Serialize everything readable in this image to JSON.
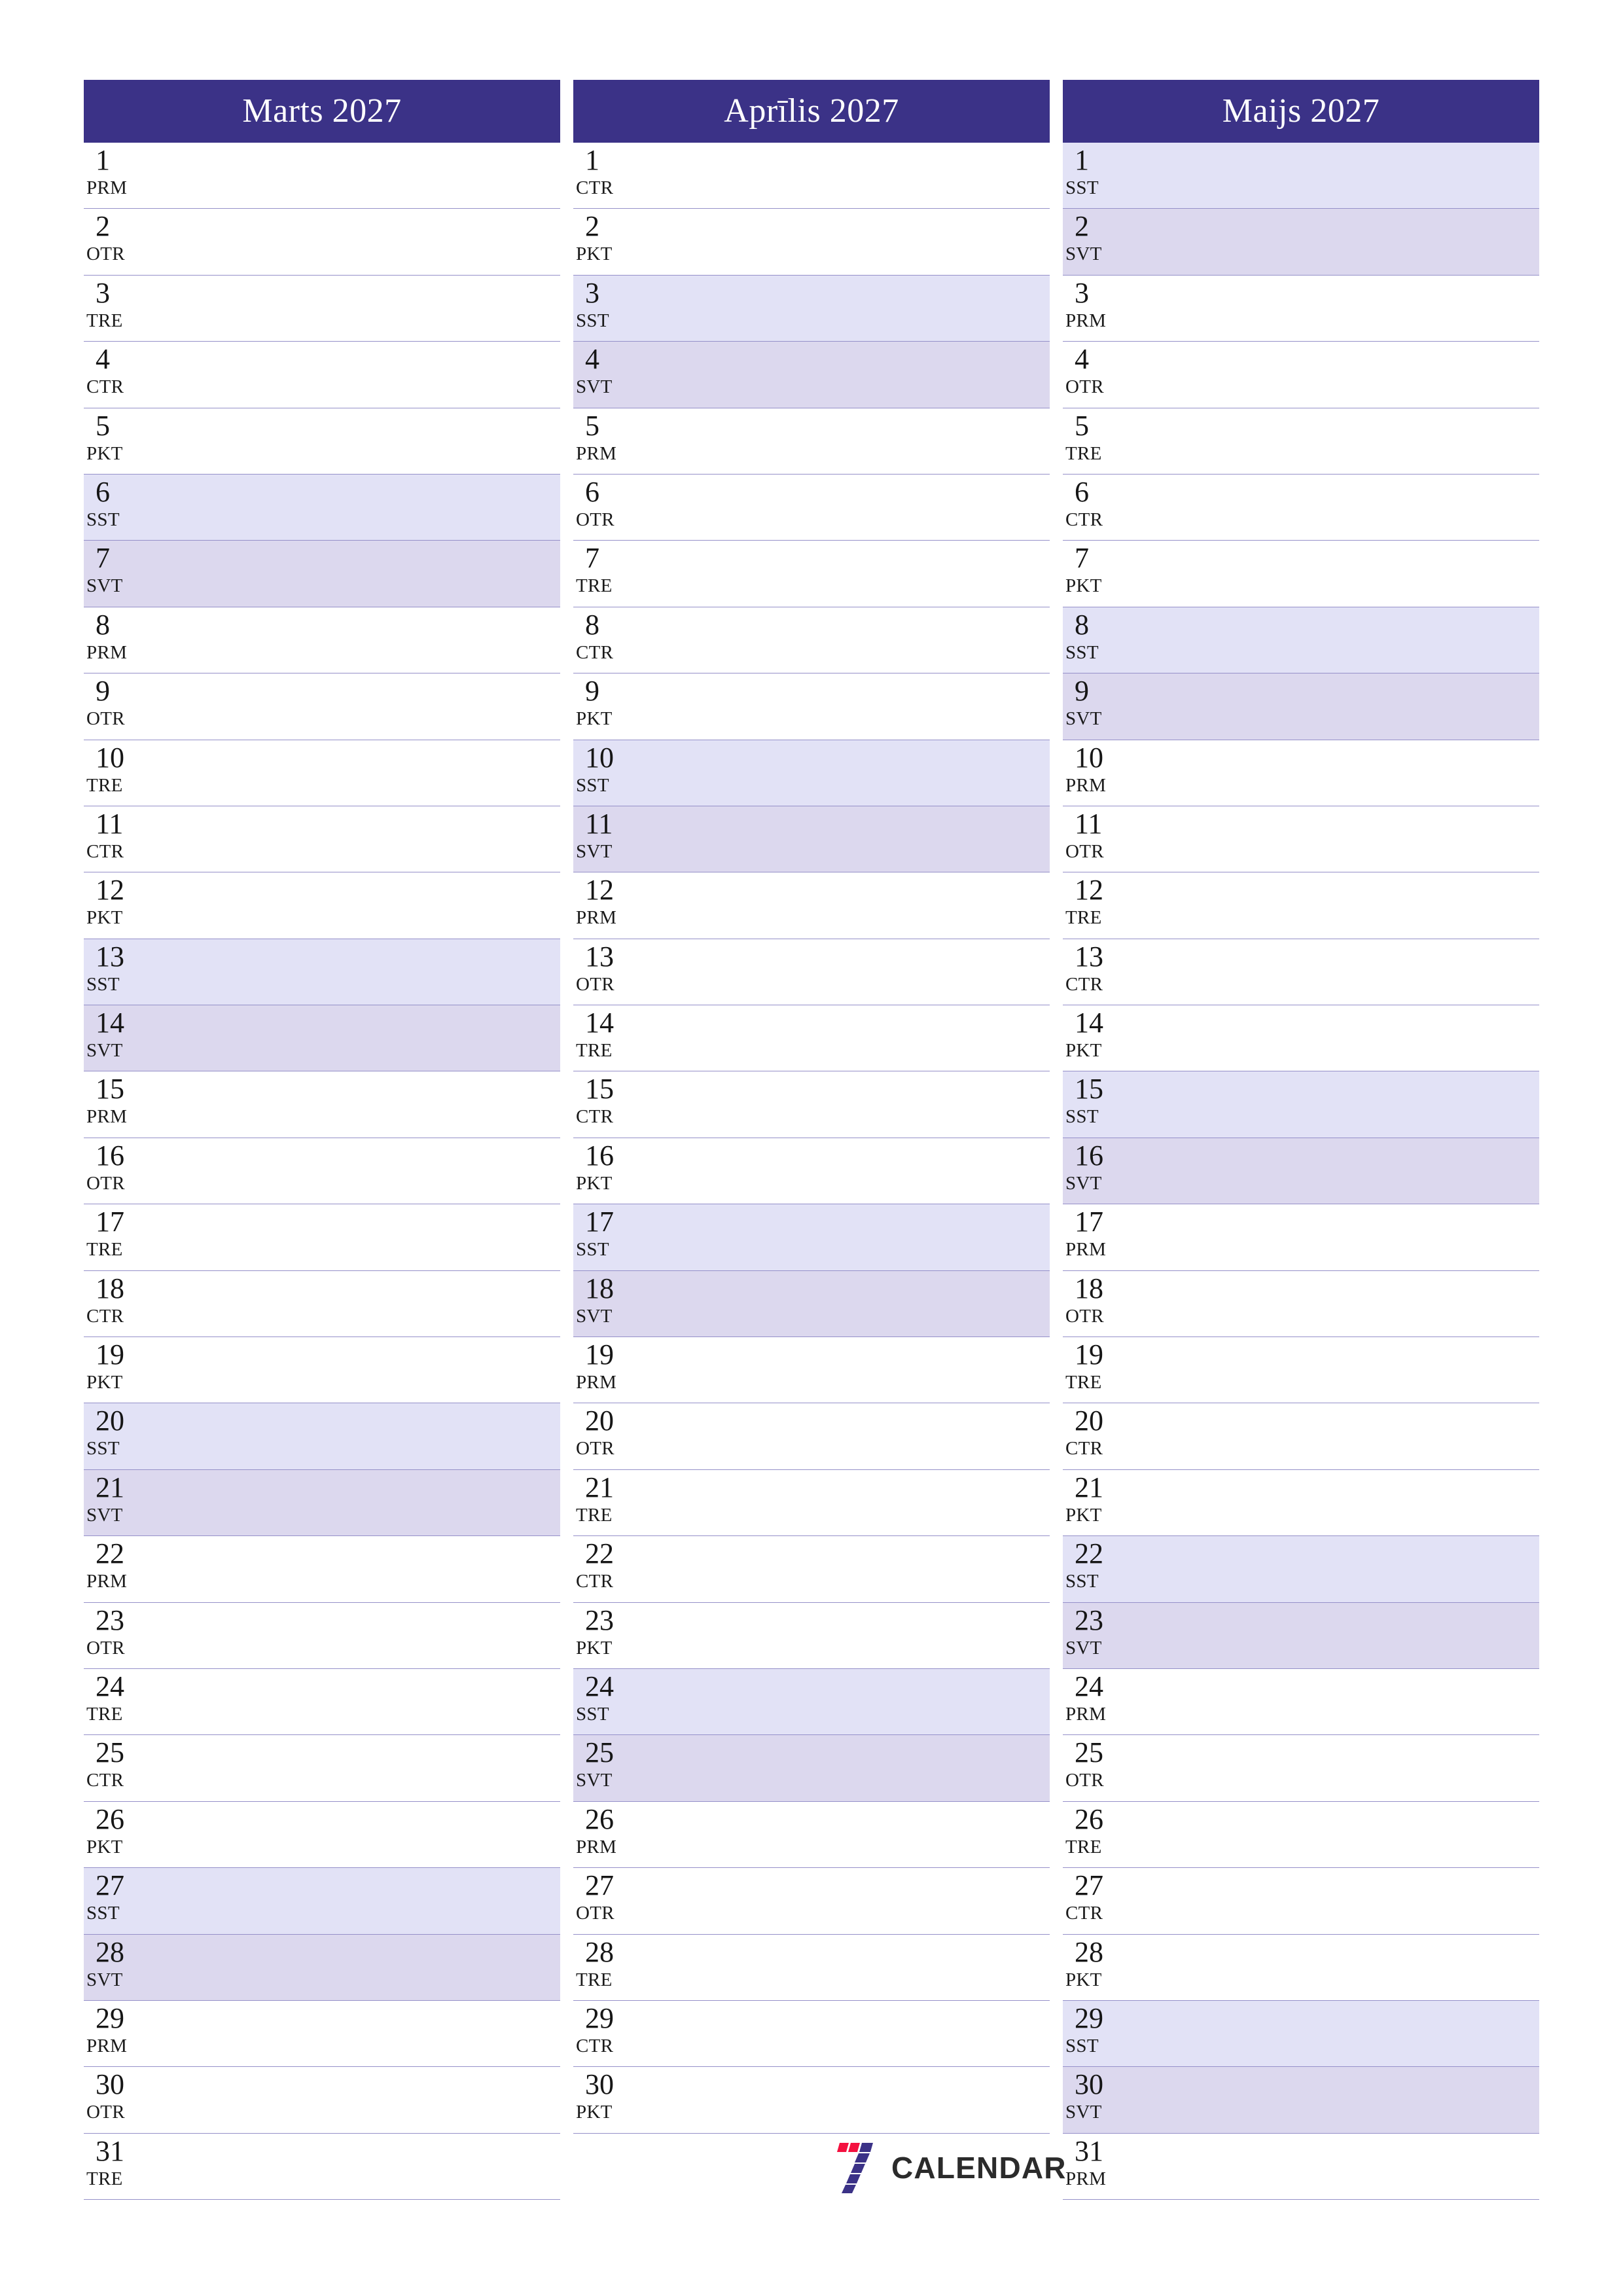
{
  "page": {
    "title": "Marts - Maijs 2027 planotajs",
    "background_color": "#ffffff",
    "header_color": "#3b3287",
    "saturday_color": "#e2e2f6",
    "sunday_color": "#dcd8ee",
    "rule_color": "#9590c9"
  },
  "weekday_abbr": {
    "monday": "PRM",
    "tuesday": "OTR",
    "wednesday": "TRE",
    "thursday": "CTR",
    "friday": "PKT",
    "saturday": "SST",
    "sunday": "SVT"
  },
  "months": [
    {
      "id": "marts",
      "title": "Marts 2027",
      "days": [
        {
          "num": "1",
          "wd": "PRM",
          "type": "weekday"
        },
        {
          "num": "2",
          "wd": "OTR",
          "type": "weekday"
        },
        {
          "num": "3",
          "wd": "TRE",
          "type": "weekday"
        },
        {
          "num": "4",
          "wd": "CTR",
          "type": "weekday"
        },
        {
          "num": "5",
          "wd": "PKT",
          "type": "weekday"
        },
        {
          "num": "6",
          "wd": "SST",
          "type": "saturday"
        },
        {
          "num": "7",
          "wd": "SVT",
          "type": "sunday"
        },
        {
          "num": "8",
          "wd": "PRM",
          "type": "weekday"
        },
        {
          "num": "9",
          "wd": "OTR",
          "type": "weekday"
        },
        {
          "num": "10",
          "wd": "TRE",
          "type": "weekday"
        },
        {
          "num": "11",
          "wd": "CTR",
          "type": "weekday"
        },
        {
          "num": "12",
          "wd": "PKT",
          "type": "weekday"
        },
        {
          "num": "13",
          "wd": "SST",
          "type": "saturday"
        },
        {
          "num": "14",
          "wd": "SVT",
          "type": "sunday"
        },
        {
          "num": "15",
          "wd": "PRM",
          "type": "weekday"
        },
        {
          "num": "16",
          "wd": "OTR",
          "type": "weekday"
        },
        {
          "num": "17",
          "wd": "TRE",
          "type": "weekday"
        },
        {
          "num": "18",
          "wd": "CTR",
          "type": "weekday"
        },
        {
          "num": "19",
          "wd": "PKT",
          "type": "weekday"
        },
        {
          "num": "20",
          "wd": "SST",
          "type": "saturday"
        },
        {
          "num": "21",
          "wd": "SVT",
          "type": "sunday"
        },
        {
          "num": "22",
          "wd": "PRM",
          "type": "weekday"
        },
        {
          "num": "23",
          "wd": "OTR",
          "type": "weekday"
        },
        {
          "num": "24",
          "wd": "TRE",
          "type": "weekday"
        },
        {
          "num": "25",
          "wd": "CTR",
          "type": "weekday"
        },
        {
          "num": "26",
          "wd": "PKT",
          "type": "weekday"
        },
        {
          "num": "27",
          "wd": "SST",
          "type": "saturday"
        },
        {
          "num": "28",
          "wd": "SVT",
          "type": "sunday"
        },
        {
          "num": "29",
          "wd": "PRM",
          "type": "weekday"
        },
        {
          "num": "30",
          "wd": "OTR",
          "type": "weekday"
        },
        {
          "num": "31",
          "wd": "TRE",
          "type": "weekday"
        }
      ]
    },
    {
      "id": "aprilis",
      "title": "Aprīlis 2027",
      "days": [
        {
          "num": "1",
          "wd": "CTR",
          "type": "weekday"
        },
        {
          "num": "2",
          "wd": "PKT",
          "type": "weekday"
        },
        {
          "num": "3",
          "wd": "SST",
          "type": "saturday"
        },
        {
          "num": "4",
          "wd": "SVT",
          "type": "sunday"
        },
        {
          "num": "5",
          "wd": "PRM",
          "type": "weekday"
        },
        {
          "num": "6",
          "wd": "OTR",
          "type": "weekday"
        },
        {
          "num": "7",
          "wd": "TRE",
          "type": "weekday"
        },
        {
          "num": "8",
          "wd": "CTR",
          "type": "weekday"
        },
        {
          "num": "9",
          "wd": "PKT",
          "type": "weekday"
        },
        {
          "num": "10",
          "wd": "SST",
          "type": "saturday"
        },
        {
          "num": "11",
          "wd": "SVT",
          "type": "sunday"
        },
        {
          "num": "12",
          "wd": "PRM",
          "type": "weekday"
        },
        {
          "num": "13",
          "wd": "OTR",
          "type": "weekday"
        },
        {
          "num": "14",
          "wd": "TRE",
          "type": "weekday"
        },
        {
          "num": "15",
          "wd": "CTR",
          "type": "weekday"
        },
        {
          "num": "16",
          "wd": "PKT",
          "type": "weekday"
        },
        {
          "num": "17",
          "wd": "SST",
          "type": "saturday"
        },
        {
          "num": "18",
          "wd": "SVT",
          "type": "sunday"
        },
        {
          "num": "19",
          "wd": "PRM",
          "type": "weekday"
        },
        {
          "num": "20",
          "wd": "OTR",
          "type": "weekday"
        },
        {
          "num": "21",
          "wd": "TRE",
          "type": "weekday"
        },
        {
          "num": "22",
          "wd": "CTR",
          "type": "weekday"
        },
        {
          "num": "23",
          "wd": "PKT",
          "type": "weekday"
        },
        {
          "num": "24",
          "wd": "SST",
          "type": "saturday"
        },
        {
          "num": "25",
          "wd": "SVT",
          "type": "sunday"
        },
        {
          "num": "26",
          "wd": "PRM",
          "type": "weekday"
        },
        {
          "num": "27",
          "wd": "OTR",
          "type": "weekday"
        },
        {
          "num": "28",
          "wd": "TRE",
          "type": "weekday"
        },
        {
          "num": "29",
          "wd": "CTR",
          "type": "weekday"
        },
        {
          "num": "30",
          "wd": "PKT",
          "type": "weekday"
        },
        {
          "num": "",
          "wd": "",
          "type": "empty"
        }
      ]
    },
    {
      "id": "maijs",
      "title": "Maijs 2027",
      "days": [
        {
          "num": "1",
          "wd": "SST",
          "type": "saturday"
        },
        {
          "num": "2",
          "wd": "SVT",
          "type": "sunday"
        },
        {
          "num": "3",
          "wd": "PRM",
          "type": "weekday"
        },
        {
          "num": "4",
          "wd": "OTR",
          "type": "weekday"
        },
        {
          "num": "5",
          "wd": "TRE",
          "type": "weekday"
        },
        {
          "num": "6",
          "wd": "CTR",
          "type": "weekday"
        },
        {
          "num": "7",
          "wd": "PKT",
          "type": "weekday"
        },
        {
          "num": "8",
          "wd": "SST",
          "type": "saturday"
        },
        {
          "num": "9",
          "wd": "SVT",
          "type": "sunday"
        },
        {
          "num": "10",
          "wd": "PRM",
          "type": "weekday"
        },
        {
          "num": "11",
          "wd": "OTR",
          "type": "weekday"
        },
        {
          "num": "12",
          "wd": "TRE",
          "type": "weekday"
        },
        {
          "num": "13",
          "wd": "CTR",
          "type": "weekday"
        },
        {
          "num": "14",
          "wd": "PKT",
          "type": "weekday"
        },
        {
          "num": "15",
          "wd": "SST",
          "type": "saturday"
        },
        {
          "num": "16",
          "wd": "SVT",
          "type": "sunday"
        },
        {
          "num": "17",
          "wd": "PRM",
          "type": "weekday"
        },
        {
          "num": "18",
          "wd": "OTR",
          "type": "weekday"
        },
        {
          "num": "19",
          "wd": "TRE",
          "type": "weekday"
        },
        {
          "num": "20",
          "wd": "CTR",
          "type": "weekday"
        },
        {
          "num": "21",
          "wd": "PKT",
          "type": "weekday"
        },
        {
          "num": "22",
          "wd": "SST",
          "type": "saturday"
        },
        {
          "num": "23",
          "wd": "SVT",
          "type": "sunday"
        },
        {
          "num": "24",
          "wd": "PRM",
          "type": "weekday"
        },
        {
          "num": "25",
          "wd": "OTR",
          "type": "weekday"
        },
        {
          "num": "26",
          "wd": "TRE",
          "type": "weekday"
        },
        {
          "num": "27",
          "wd": "CTR",
          "type": "weekday"
        },
        {
          "num": "28",
          "wd": "PKT",
          "type": "weekday"
        },
        {
          "num": "29",
          "wd": "SST",
          "type": "saturday"
        },
        {
          "num": "30",
          "wd": "SVT",
          "type": "sunday"
        },
        {
          "num": "31",
          "wd": "PRM",
          "type": "weekday"
        }
      ]
    }
  ],
  "logo": {
    "text": "CALENDAR",
    "mark_name": "seven-logo-mark",
    "accent_red": "#f4113f",
    "accent_blue": "#3b3287"
  }
}
